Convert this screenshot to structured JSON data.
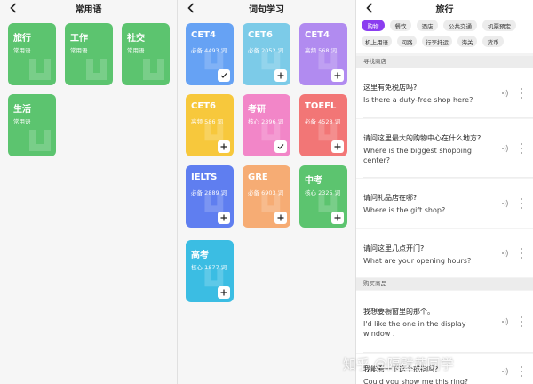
{
  "panel1": {
    "title": "常用语",
    "cards": [
      {
        "title": "旅行",
        "subtitle": "常用语",
        "color": "#5cc46f"
      },
      {
        "title": "工作",
        "subtitle": "常用语",
        "color": "#5cc46f"
      },
      {
        "title": "社交",
        "subtitle": "常用语",
        "color": "#5cc46f"
      },
      {
        "title": "生活",
        "subtitle": "常用语",
        "color": "#5cc46f"
      }
    ]
  },
  "panel2": {
    "title": "词句学习",
    "cards": [
      {
        "title": "CET4",
        "subtitle": "必备 4493 词",
        "color": "#66a2f4",
        "state": "check"
      },
      {
        "title": "CET6",
        "subtitle": "必备 2052 词",
        "color": "#7ccbe8",
        "state": "plus"
      },
      {
        "title": "CET4",
        "subtitle": "高频 568 词",
        "color": "#b18bf0",
        "state": "plus"
      },
      {
        "title": "CET6",
        "subtitle": "高频 586 词",
        "color": "#f7c83c",
        "state": "plus"
      },
      {
        "title": "考研",
        "subtitle": "核心 2396 词",
        "color": "#f286c8",
        "state": "check"
      },
      {
        "title": "TOEFL",
        "subtitle": "必备 4528 词",
        "color": "#f27676",
        "state": "plus"
      },
      {
        "title": "IELTS",
        "subtitle": "必备 2889 词",
        "color": "#5f7ef0",
        "state": "plus"
      },
      {
        "title": "GRE",
        "subtitle": "必备 6903 词",
        "color": "#f6ac74",
        "state": "plus"
      },
      {
        "title": "中考",
        "subtitle": "核心 2325 词",
        "color": "#5cc46f",
        "state": "plus"
      },
      {
        "title": "高考",
        "subtitle": "核心 1877 词",
        "color": "#3bbde3",
        "state": "plus"
      }
    ]
  },
  "panel3": {
    "title": "旅行",
    "accent": "#8b3df0",
    "chips": [
      "购物",
      "餐饮",
      "酒店",
      "公共交通",
      "机票预定",
      "机上用语",
      "问路",
      "行李托运",
      "海关",
      "货币"
    ],
    "sections": [
      {
        "header": "寻找商店",
        "items": [
          {
            "zh": "这里有免税店吗?",
            "en": "Is there a duty-free shop here?"
          },
          {
            "zh": "请问这里最大的购物中心在什么地方?",
            "en": "Where is the biggest shopping center?"
          },
          {
            "zh": "请问礼品店在哪?",
            "en": "Where is the gift shop?"
          },
          {
            "zh": "请问这里几点开门?",
            "en": "What are your opening hours?"
          }
        ]
      },
      {
        "header": "购买商品",
        "items": [
          {
            "zh": "我想要橱窗里的那个。",
            "en": "I'd like the one in the display window ."
          },
          {
            "zh": "我能看一下这个戒指吗?",
            "en": "Could you show me this ring?"
          }
        ]
      }
    ]
  },
  "watermark": "知乎 @隔壁黄同学"
}
